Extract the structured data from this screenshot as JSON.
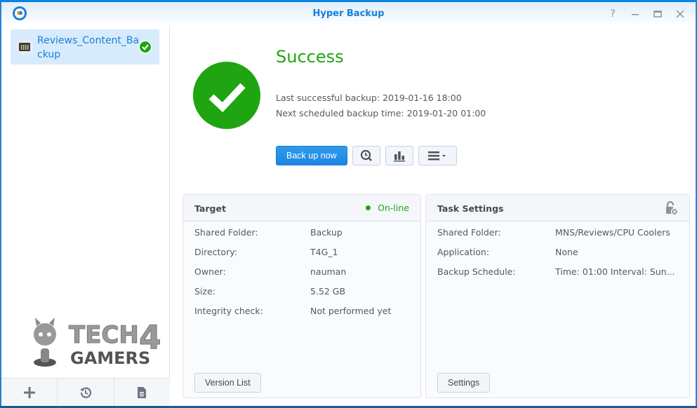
{
  "window": {
    "title": "Hyper Backup",
    "controls": {
      "help": "help-icon",
      "minimize": "minimize-icon",
      "maximize": "maximize-icon",
      "close": "close-icon"
    }
  },
  "sidebar": {
    "tasks": [
      {
        "label": "Reviews_Content_Backup",
        "status": "success",
        "icon": "nas-icon"
      }
    ],
    "footer": [
      {
        "name": "add",
        "icon": "plus-icon"
      },
      {
        "name": "restore",
        "icon": "history-icon"
      },
      {
        "name": "log",
        "icon": "document-icon"
      }
    ],
    "watermark": {
      "line1": "TECH",
      "digit": "4",
      "line2": "GAMERS"
    }
  },
  "status": {
    "title": "Success",
    "last_backup": "Last successful backup: 2019-01-16 18:00",
    "next_backup": "Next scheduled backup time: 2019-01-20 01:00",
    "color": "#1fa511"
  },
  "actions": {
    "backup_now": "Back up now",
    "buttons": [
      "restore-icon",
      "statistics-icon",
      "menu-icon"
    ]
  },
  "target": {
    "title": "Target",
    "status": "On-line",
    "rows": [
      {
        "key": "Shared Folder:",
        "value": "Backup"
      },
      {
        "key": "Directory:",
        "value": "T4G_1"
      },
      {
        "key": "Owner:",
        "value": "nauman"
      },
      {
        "key": "Size:",
        "value": "5.52 GB"
      },
      {
        "key": "Integrity check:",
        "value": "Not performed yet"
      }
    ],
    "button": "Version List"
  },
  "task_settings": {
    "title": "Task Settings",
    "rows": [
      {
        "key": "Shared Folder:",
        "value": "MNS/Reviews/CPU Coolers"
      },
      {
        "key": "Application:",
        "value": "None"
      },
      {
        "key": "Backup Schedule:",
        "value": "Time: 01:00 Interval: Sun..."
      }
    ],
    "button": "Settings"
  }
}
